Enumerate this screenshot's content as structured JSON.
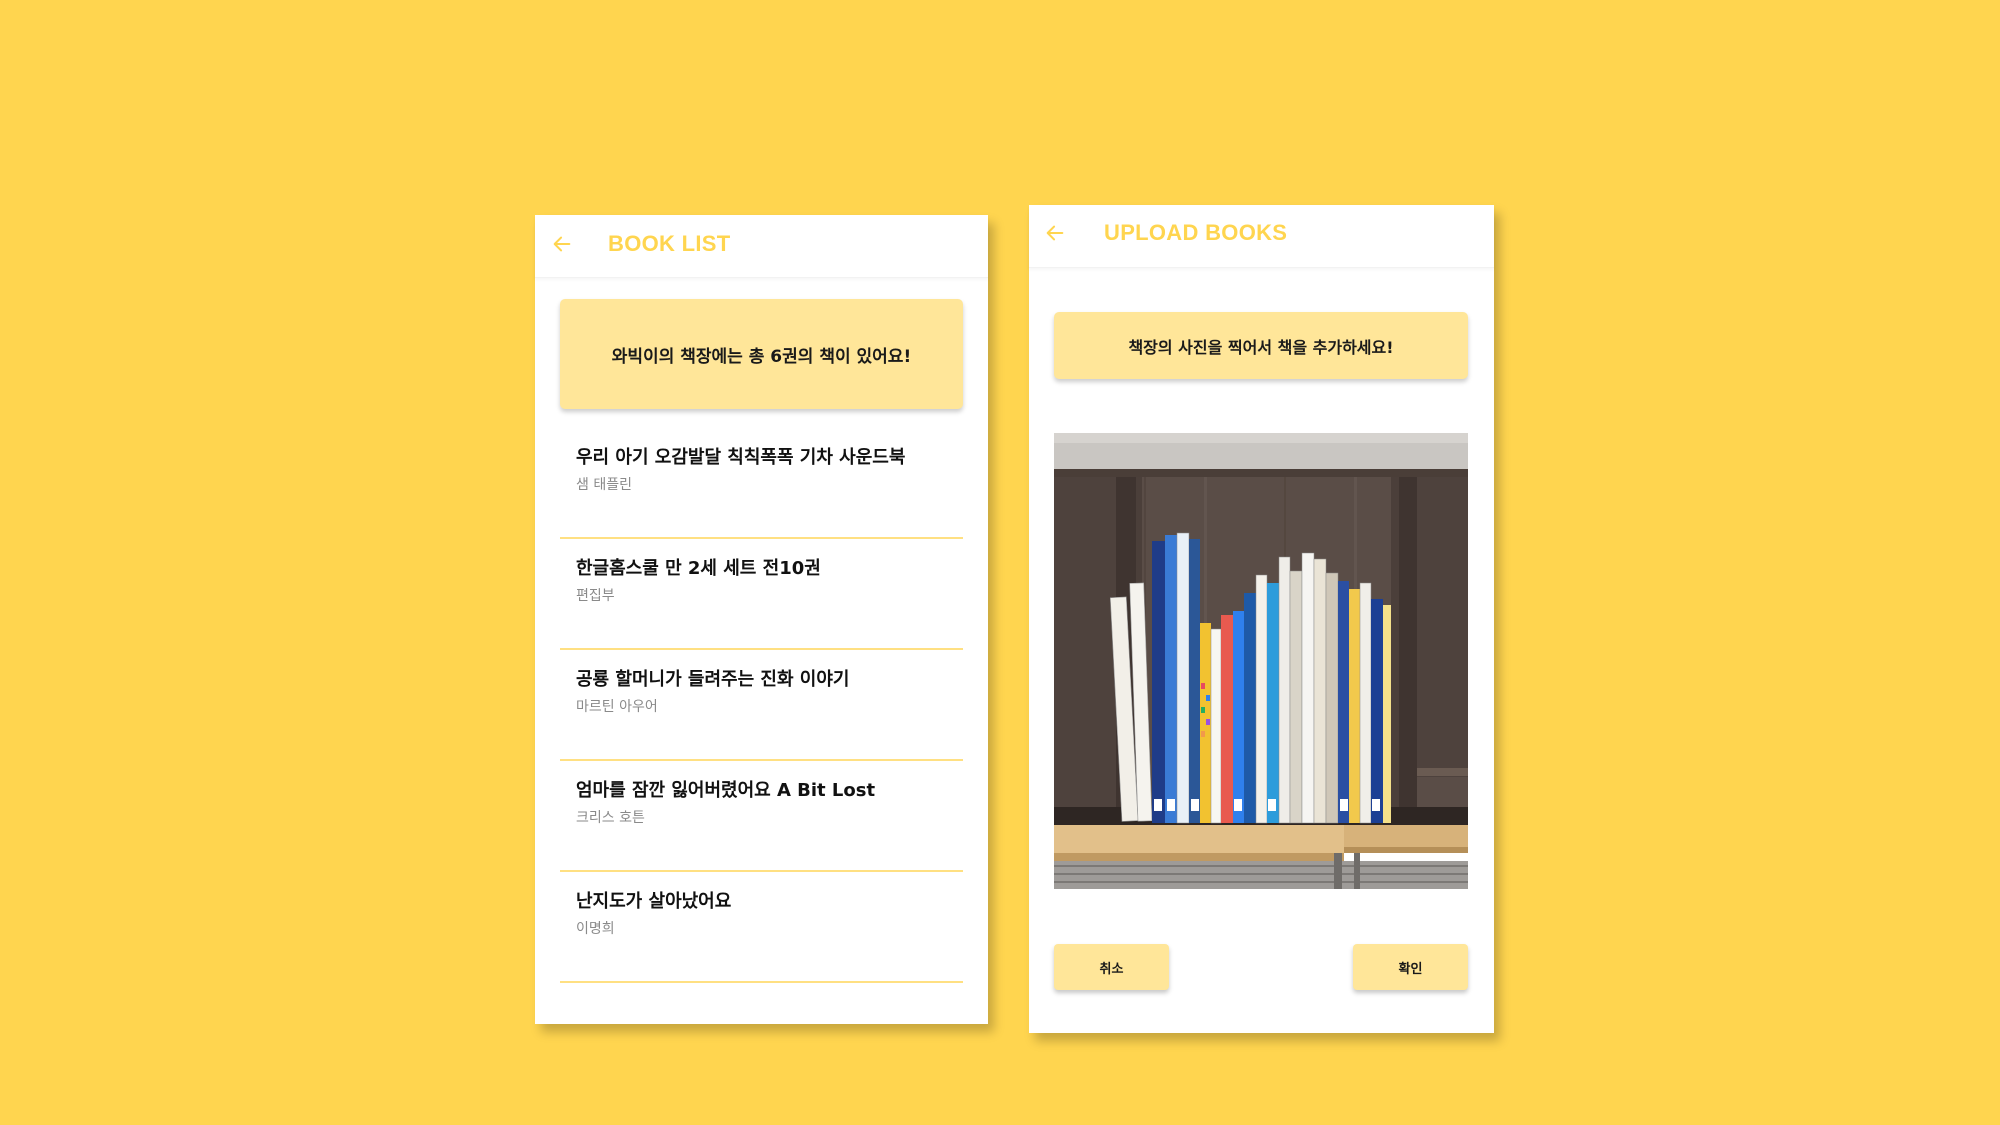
{
  "book_list_screen": {
    "title": "BOOK LIST",
    "back_icon": "arrow-left-icon",
    "count_banner": "와빅이의 책장에는 총 6권의 책이 있어요!",
    "books": [
      {
        "title": "우리 아기 오감발달 칙칙폭폭 기차 사운드북",
        "author": "샘 태플린"
      },
      {
        "title": "한글홈스쿨 만 2세 세트 전10권",
        "author": "편집부"
      },
      {
        "title": "공룡 할머니가 들려주는 진화 이야기",
        "author": "마르틴 아우어"
      },
      {
        "title": "엄마를 잠깐 잃어버렸어요 A Bit Lost",
        "author": "크리스 호튼"
      },
      {
        "title": "난지도가 살아났어요",
        "author": "이명희"
      }
    ]
  },
  "upload_screen": {
    "title": "UPLOAD BOOKS",
    "back_icon": "arrow-left-icon",
    "instruction": "책장의 사진을 찍어서 책을 추가하세요!",
    "photo": "bookshelf-photo",
    "cancel_label": "취소",
    "confirm_label": "확인"
  },
  "colors": {
    "background": "#FFD54F",
    "accent": "#FFD54F",
    "banner": "#FFE699",
    "divider": "#FFE082",
    "card": "#FFFFFF",
    "title_text": "#111111",
    "author_text": "#8A8A8A"
  }
}
